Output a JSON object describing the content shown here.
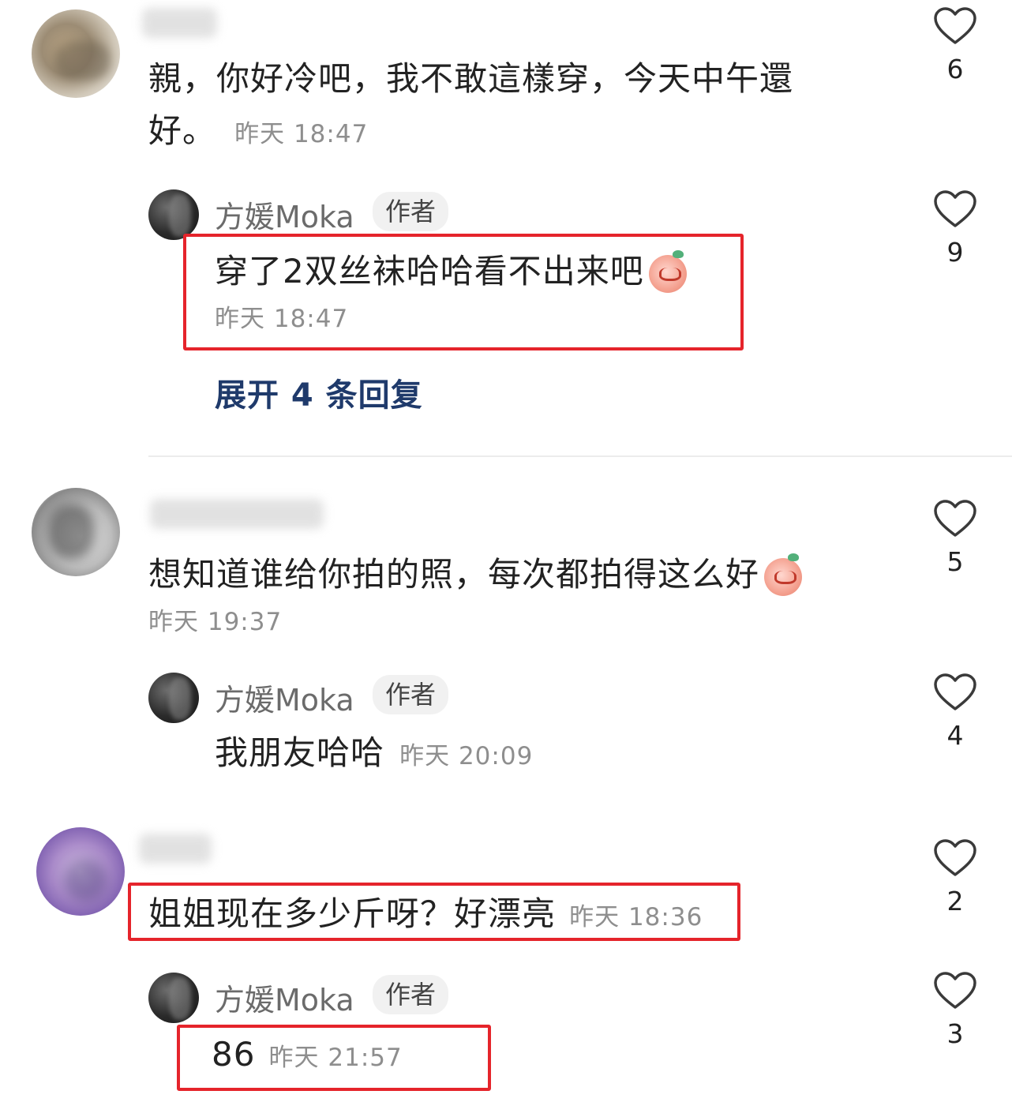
{
  "comment1": {
    "text_line1": "親，你好冷吧，我不敢這樣穿，今天中午還",
    "text_line2": "好。",
    "time": "昨天 18:47",
    "likes": "6"
  },
  "reply1": {
    "author": "方媛Moka",
    "badge": "作者",
    "text": "穿了2双丝袜哈哈看不出来吧",
    "time": "昨天 18:47",
    "likes": "9"
  },
  "expand_replies": "展开 4 条回复",
  "comment2": {
    "text": "想知道谁给你拍的照，每次都拍得这么好",
    "time": "昨天 19:37",
    "likes": "5"
  },
  "reply2": {
    "author": "方媛Moka",
    "badge": "作者",
    "text": "我朋友哈哈",
    "time": "昨天 20:09",
    "likes": "4"
  },
  "comment3": {
    "text": "姐姐现在多少斤呀？好漂亮",
    "time": "昨天 18:36",
    "likes": "2"
  },
  "reply3": {
    "author": "方媛Moka",
    "badge": "作者",
    "text": "86",
    "time": "昨天 21:57",
    "likes": "3"
  },
  "colors": {
    "highlight": "#e5242b",
    "expand_link": "#1f3a6b"
  },
  "icons": {
    "like": "heart-outline-icon",
    "emoji": "laughing-peach-emoji"
  }
}
